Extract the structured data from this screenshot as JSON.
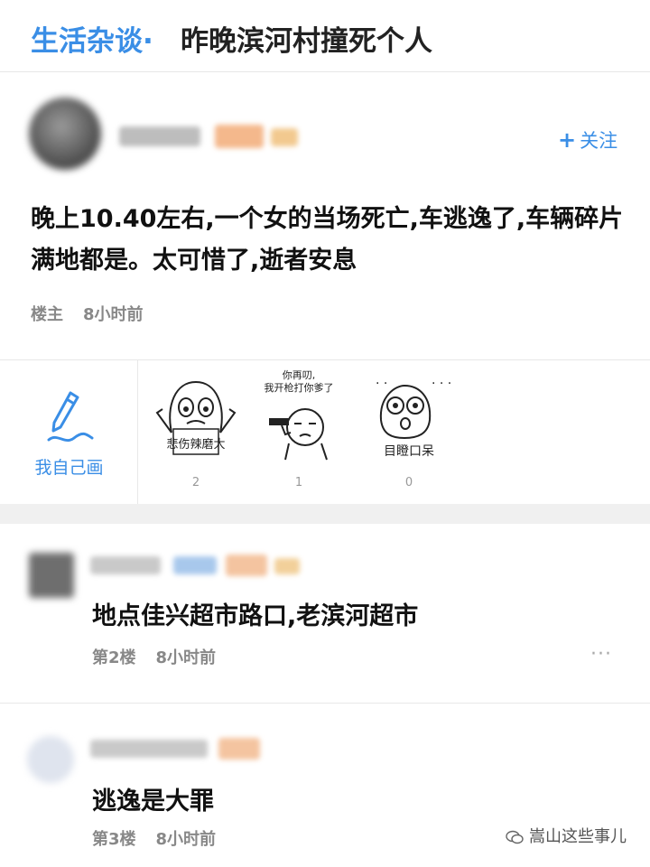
{
  "header": {
    "forum": "生活杂谈",
    "separator": "·",
    "title": "昨晚滨河村撞死个人"
  },
  "post": {
    "follow_label": "关注",
    "follow_icon": "plus-icon",
    "content": "晚上10.40左右,一个女的当场死亡,车逃逸了,车辆碎片满地都是。太可惜了,逝者安息",
    "floor": "楼主",
    "time": "8小时前"
  },
  "stickers": {
    "draw_label": "我自己画",
    "draw_icon": "pen-icon",
    "items": [
      {
        "caption": "悲伤辣磨大",
        "count": "2"
      },
      {
        "caption": "你再叨,\n我开枪打你爹了",
        "count": "1"
      },
      {
        "caption": "目瞪口呆",
        "count": "0"
      }
    ]
  },
  "replies": [
    {
      "text": "地点佳兴超市路口,老滨河超市",
      "floor": "第2楼",
      "time": "8小时前",
      "more": "···"
    },
    {
      "text": "逃逸是大罪",
      "floor": "第3楼",
      "time": "8小时前"
    }
  ],
  "watermark": "嵩山这些事儿"
}
